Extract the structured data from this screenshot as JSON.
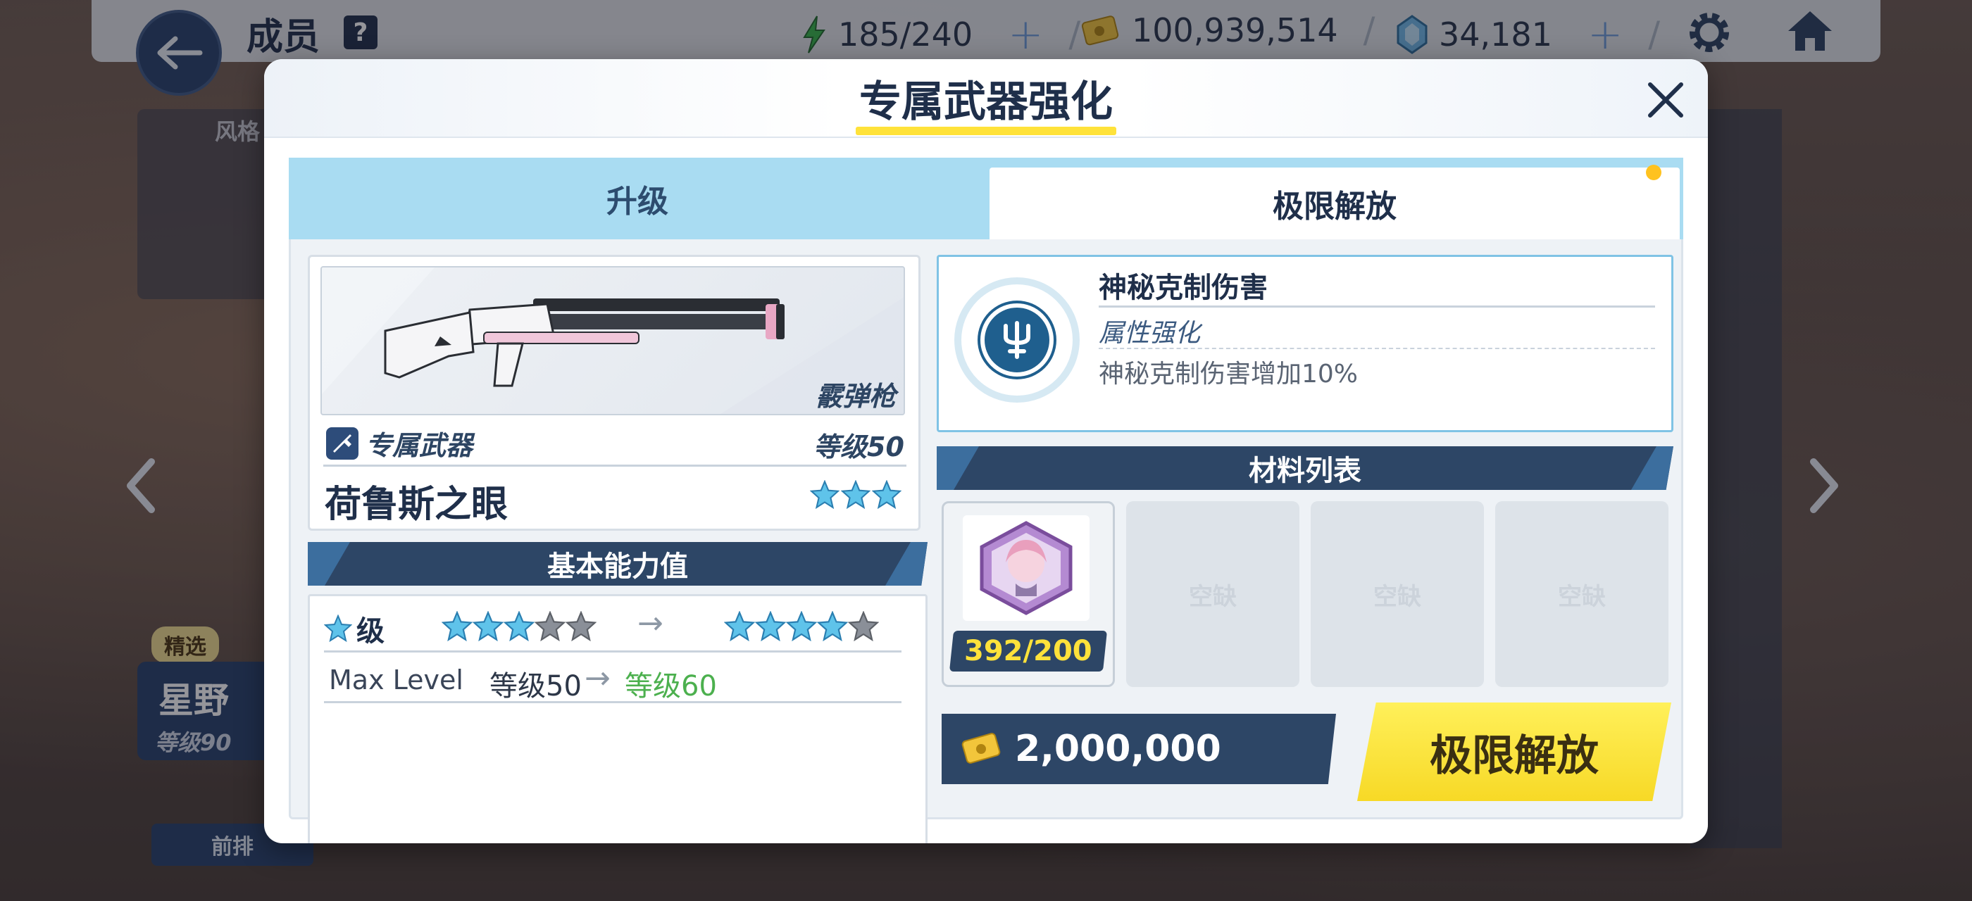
{
  "topbar": {
    "title": "成员",
    "help_icon": "?",
    "ap": "185/240",
    "credits": "100,939,514",
    "gems": "34,181"
  },
  "background": {
    "left_card_label": "风格",
    "character_badge": "精选",
    "character_name": "星野",
    "character_level": "等级90",
    "character_position": "前排"
  },
  "modal": {
    "title": "专属武器强化",
    "tabs": [
      {
        "label": "升级"
      },
      {
        "label": "极限解放"
      }
    ],
    "weapon": {
      "type": "霰弹枪",
      "exclusive_label": "专属武器",
      "level": "等级50",
      "name": "荷鲁斯之眼"
    },
    "stats": {
      "banner": "基本能力值",
      "star_label": "级",
      "stars_from": 3,
      "stars_to": 4,
      "stars_total": 5,
      "max_level_label": "Max Level",
      "max_level_from": "等级50",
      "max_level_to": "等级60",
      "arrow": "→"
    },
    "effect": {
      "title": "神秘克制伤害",
      "subtitle": "属性强化",
      "description": "神秘克制伤害增加10%"
    },
    "materials": {
      "banner": "材料列表",
      "owned_count": "392/200",
      "empty_slots": [
        "空缺",
        "空缺",
        "空缺"
      ]
    },
    "cost": "2,000,000",
    "action_button": "极限解放"
  },
  "colors": {
    "navy": "#2d4666",
    "accent_yellow": "#ffe23a",
    "tab_blue": "#a9dcf2",
    "green": "#4cb04e"
  }
}
